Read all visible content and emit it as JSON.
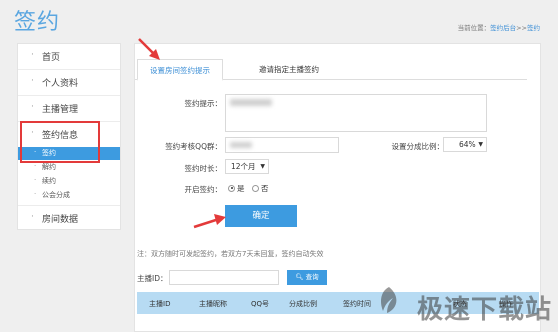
{
  "header": {
    "title": "签约",
    "breadcrumb_prefix": "当前位置：",
    "breadcrumb_link": "签约后台",
    "breadcrumb_sep": ">>",
    "breadcrumb_current": "签约"
  },
  "sidebar": {
    "items": [
      {
        "label": "首页"
      },
      {
        "label": "个人资料"
      },
      {
        "label": "主播管理"
      },
      {
        "label": "签约信息"
      }
    ],
    "sub_items": [
      {
        "label": "签约",
        "active": true
      },
      {
        "label": "解约"
      },
      {
        "label": "续约"
      },
      {
        "label": "公会分成"
      }
    ],
    "last_item": {
      "label": "房间数据"
    }
  },
  "tabs": [
    {
      "label": "设置房间签约提示",
      "active": true
    },
    {
      "label": "邀请指定主播签约"
    }
  ],
  "form": {
    "tip_label": "签约提示：",
    "qq_label": "签约考核QQ群：",
    "ratio_label": "设置分成比例：",
    "ratio_value": "64%",
    "duration_label": "签约时长：",
    "duration_value": "12个月",
    "enable_label": "开启签约：",
    "yes_label": "是",
    "no_label": "否",
    "confirm_label": "确定"
  },
  "note": "注：双方随时可发起签约，若双方7天未回复，签约自动失效",
  "search": {
    "label": "主播ID：",
    "button": "查询"
  },
  "table": {
    "headers": [
      "主播ID",
      "主播昵称",
      "QQ号",
      "分成比例",
      "签约时间",
      "状态",
      "操作"
    ]
  },
  "watermark": "极速下载站",
  "colors": {
    "accent": "#3d9be0",
    "highlight": "#e33a3a",
    "table_header": "#b7dbf3"
  }
}
